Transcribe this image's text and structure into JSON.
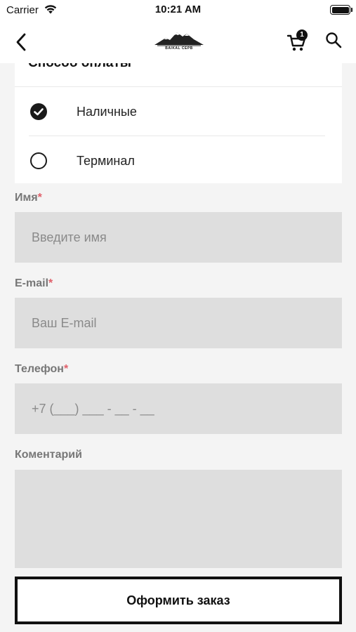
{
  "status_bar": {
    "carrier": "Carrier",
    "time": "10:21 AM"
  },
  "nav": {
    "logo_text": "BAIKAL CEPB",
    "cart_count": "1"
  },
  "payment": {
    "title": "Способ оплаты",
    "options": [
      {
        "label": "Наличные",
        "selected": true
      },
      {
        "label": "Терминал",
        "selected": false
      }
    ]
  },
  "form": {
    "name": {
      "label": "Имя",
      "required_mark": "*",
      "placeholder": "Введите имя"
    },
    "email": {
      "label": "E-mail",
      "required_mark": "*",
      "placeholder": "Ваш E-mail"
    },
    "phone": {
      "label": "Телефон",
      "required_mark": "*",
      "placeholder": "+7 (___) ___ - __ - __"
    },
    "comment": {
      "label": "Коментарий",
      "placeholder": ""
    }
  },
  "submit_label": "Оформить заказ",
  "colors": {
    "background": "#f4f4f4",
    "field": "#dedede",
    "required": "#e0606a",
    "primary": "#111111"
  }
}
